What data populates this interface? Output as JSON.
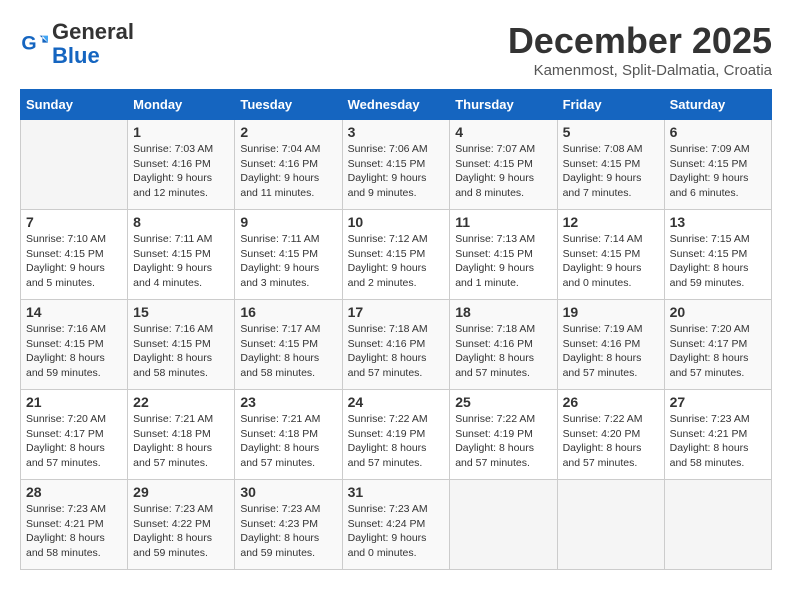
{
  "header": {
    "logo_general": "General",
    "logo_blue": "Blue",
    "month": "December 2025",
    "location": "Kamenmost, Split-Dalmatia, Croatia"
  },
  "weekdays": [
    "Sunday",
    "Monday",
    "Tuesday",
    "Wednesday",
    "Thursday",
    "Friday",
    "Saturday"
  ],
  "weeks": [
    [
      {
        "day": "",
        "info": ""
      },
      {
        "day": "1",
        "info": "Sunrise: 7:03 AM\nSunset: 4:16 PM\nDaylight: 9 hours\nand 12 minutes."
      },
      {
        "day": "2",
        "info": "Sunrise: 7:04 AM\nSunset: 4:16 PM\nDaylight: 9 hours\nand 11 minutes."
      },
      {
        "day": "3",
        "info": "Sunrise: 7:06 AM\nSunset: 4:15 PM\nDaylight: 9 hours\nand 9 minutes."
      },
      {
        "day": "4",
        "info": "Sunrise: 7:07 AM\nSunset: 4:15 PM\nDaylight: 9 hours\nand 8 minutes."
      },
      {
        "day": "5",
        "info": "Sunrise: 7:08 AM\nSunset: 4:15 PM\nDaylight: 9 hours\nand 7 minutes."
      },
      {
        "day": "6",
        "info": "Sunrise: 7:09 AM\nSunset: 4:15 PM\nDaylight: 9 hours\nand 6 minutes."
      }
    ],
    [
      {
        "day": "7",
        "info": "Sunrise: 7:10 AM\nSunset: 4:15 PM\nDaylight: 9 hours\nand 5 minutes."
      },
      {
        "day": "8",
        "info": "Sunrise: 7:11 AM\nSunset: 4:15 PM\nDaylight: 9 hours\nand 4 minutes."
      },
      {
        "day": "9",
        "info": "Sunrise: 7:11 AM\nSunset: 4:15 PM\nDaylight: 9 hours\nand 3 minutes."
      },
      {
        "day": "10",
        "info": "Sunrise: 7:12 AM\nSunset: 4:15 PM\nDaylight: 9 hours\nand 2 minutes."
      },
      {
        "day": "11",
        "info": "Sunrise: 7:13 AM\nSunset: 4:15 PM\nDaylight: 9 hours\nand 1 minute."
      },
      {
        "day": "12",
        "info": "Sunrise: 7:14 AM\nSunset: 4:15 PM\nDaylight: 9 hours\nand 0 minutes."
      },
      {
        "day": "13",
        "info": "Sunrise: 7:15 AM\nSunset: 4:15 PM\nDaylight: 8 hours\nand 59 minutes."
      }
    ],
    [
      {
        "day": "14",
        "info": "Sunrise: 7:16 AM\nSunset: 4:15 PM\nDaylight: 8 hours\nand 59 minutes."
      },
      {
        "day": "15",
        "info": "Sunrise: 7:16 AM\nSunset: 4:15 PM\nDaylight: 8 hours\nand 58 minutes."
      },
      {
        "day": "16",
        "info": "Sunrise: 7:17 AM\nSunset: 4:15 PM\nDaylight: 8 hours\nand 58 minutes."
      },
      {
        "day": "17",
        "info": "Sunrise: 7:18 AM\nSunset: 4:16 PM\nDaylight: 8 hours\nand 57 minutes."
      },
      {
        "day": "18",
        "info": "Sunrise: 7:18 AM\nSunset: 4:16 PM\nDaylight: 8 hours\nand 57 minutes."
      },
      {
        "day": "19",
        "info": "Sunrise: 7:19 AM\nSunset: 4:16 PM\nDaylight: 8 hours\nand 57 minutes."
      },
      {
        "day": "20",
        "info": "Sunrise: 7:20 AM\nSunset: 4:17 PM\nDaylight: 8 hours\nand 57 minutes."
      }
    ],
    [
      {
        "day": "21",
        "info": "Sunrise: 7:20 AM\nSunset: 4:17 PM\nDaylight: 8 hours\nand 57 minutes."
      },
      {
        "day": "22",
        "info": "Sunrise: 7:21 AM\nSunset: 4:18 PM\nDaylight: 8 hours\nand 57 minutes."
      },
      {
        "day": "23",
        "info": "Sunrise: 7:21 AM\nSunset: 4:18 PM\nDaylight: 8 hours\nand 57 minutes."
      },
      {
        "day": "24",
        "info": "Sunrise: 7:22 AM\nSunset: 4:19 PM\nDaylight: 8 hours\nand 57 minutes."
      },
      {
        "day": "25",
        "info": "Sunrise: 7:22 AM\nSunset: 4:19 PM\nDaylight: 8 hours\nand 57 minutes."
      },
      {
        "day": "26",
        "info": "Sunrise: 7:22 AM\nSunset: 4:20 PM\nDaylight: 8 hours\nand 57 minutes."
      },
      {
        "day": "27",
        "info": "Sunrise: 7:23 AM\nSunset: 4:21 PM\nDaylight: 8 hours\nand 58 minutes."
      }
    ],
    [
      {
        "day": "28",
        "info": "Sunrise: 7:23 AM\nSunset: 4:21 PM\nDaylight: 8 hours\nand 58 minutes."
      },
      {
        "day": "29",
        "info": "Sunrise: 7:23 AM\nSunset: 4:22 PM\nDaylight: 8 hours\nand 59 minutes."
      },
      {
        "day": "30",
        "info": "Sunrise: 7:23 AM\nSunset: 4:23 PM\nDaylight: 8 hours\nand 59 minutes."
      },
      {
        "day": "31",
        "info": "Sunrise: 7:23 AM\nSunset: 4:24 PM\nDaylight: 9 hours\nand 0 minutes."
      },
      {
        "day": "",
        "info": ""
      },
      {
        "day": "",
        "info": ""
      },
      {
        "day": "",
        "info": ""
      }
    ]
  ]
}
